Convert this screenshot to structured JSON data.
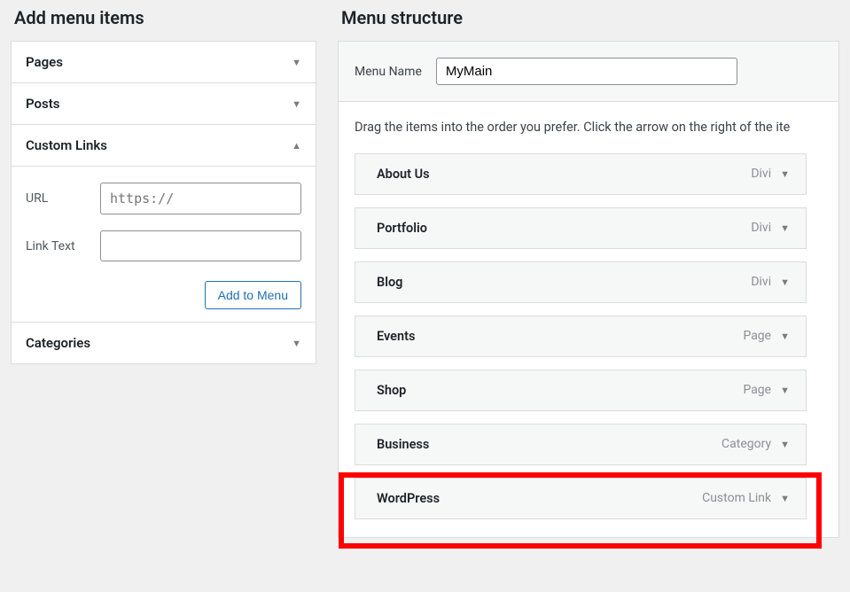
{
  "left": {
    "title": "Add menu items",
    "accordion": [
      {
        "label": "Pages",
        "expanded": false
      },
      {
        "label": "Posts",
        "expanded": false
      },
      {
        "label": "Custom Links",
        "expanded": true
      },
      {
        "label": "Categories",
        "expanded": false
      }
    ],
    "custom_links": {
      "url_label": "URL",
      "url_placeholder": "https://",
      "link_text_label": "Link Text",
      "link_text_value": "",
      "add_button": "Add to Menu"
    }
  },
  "right": {
    "title": "Menu structure",
    "menu_name_label": "Menu Name",
    "menu_name_value": "MyMain",
    "instructions": "Drag the items into the order you prefer. Click the arrow on the right of the ite",
    "items": [
      {
        "title": "About Us",
        "type": "Divi"
      },
      {
        "title": "Portfolio",
        "type": "Divi"
      },
      {
        "title": "Blog",
        "type": "Divi"
      },
      {
        "title": "Events",
        "type": "Page"
      },
      {
        "title": "Shop",
        "type": "Page"
      },
      {
        "title": "Business",
        "type": "Category"
      },
      {
        "title": "WordPress",
        "type": "Custom Link"
      }
    ],
    "highlighted_index": 6
  }
}
